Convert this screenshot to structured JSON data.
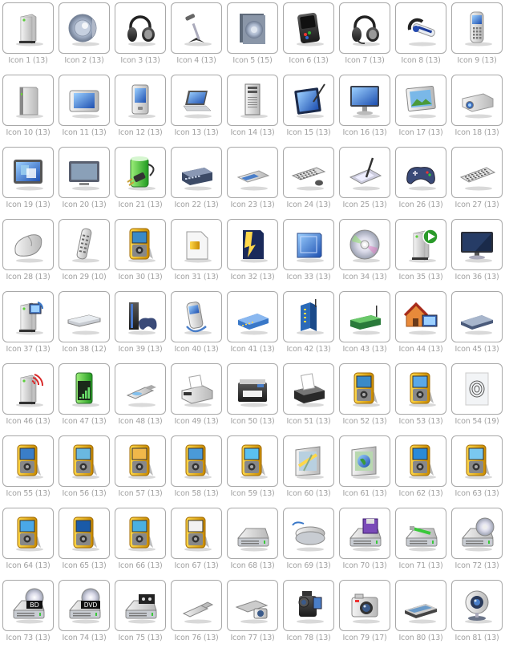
{
  "gallery": {
    "columns": 9,
    "label_color": "#a0a0a0",
    "tile_border_color": "#a8a8a8",
    "items": [
      {
        "label": "Icon 1 (13)",
        "icon": "external-drive-icon"
      },
      {
        "label": "Icon 2 (13)",
        "icon": "speaker-icon"
      },
      {
        "label": "Icon 3 (13)",
        "icon": "headphones-icon"
      },
      {
        "label": "Icon 4 (13)",
        "icon": "desk-microphone-icon"
      },
      {
        "label": "Icon 5 (15)",
        "icon": "speaker-box-icon"
      },
      {
        "label": "Icon 6 (13)",
        "icon": "media-player-icon"
      },
      {
        "label": "Icon 7 (13)",
        "icon": "headset-icon"
      },
      {
        "label": "Icon 8 (13)",
        "icon": "bluetooth-headset-icon"
      },
      {
        "label": "Icon 9 (13)",
        "icon": "mobile-phone-icon"
      },
      {
        "label": "Icon 10 (13)",
        "icon": "hard-drive-slim-icon"
      },
      {
        "label": "Icon 11 (13)",
        "icon": "tablet-pc-icon"
      },
      {
        "label": "Icon 12 (13)",
        "icon": "pda-icon"
      },
      {
        "label": "Icon 13 (13)",
        "icon": "laptop-icon"
      },
      {
        "label": "Icon 14 (13)",
        "icon": "tower-computer-icon"
      },
      {
        "label": "Icon 15 (13)",
        "icon": "pen-tablet-display-icon"
      },
      {
        "label": "Icon 16 (13)",
        "icon": "monitor-icon"
      },
      {
        "label": "Icon 17 (13)",
        "icon": "photo-frame-icon"
      },
      {
        "label": "Icon 18 (13)",
        "icon": "projector-icon"
      },
      {
        "label": "Icon 19 (13)",
        "icon": "display-settings-icon"
      },
      {
        "label": "Icon 20 (13)",
        "icon": "flat-screen-tv-icon"
      },
      {
        "label": "Icon 21 (13)",
        "icon": "battery-power-plug-icon"
      },
      {
        "label": "Icon 22 (13)",
        "icon": "network-switch-icon"
      },
      {
        "label": "Icon 23 (13)",
        "icon": "scanner-flat-icon"
      },
      {
        "label": "Icon 24 (13)",
        "icon": "keyboard-mouse-icon"
      },
      {
        "label": "Icon 25 (13)",
        "icon": "graphics-tablet-icon"
      },
      {
        "label": "Icon 26 (13)",
        "icon": "gamepad-icon"
      },
      {
        "label": "Icon 27 (13)",
        "icon": "keyboard-icon"
      },
      {
        "label": "Icon 28 (13)",
        "icon": "mouse-icon"
      },
      {
        "label": "Icon 29 (10)",
        "icon": "remote-control-icon"
      },
      {
        "label": "Icon 30 (13)",
        "icon": "portable-media-device-icon"
      },
      {
        "label": "Icon 31 (13)",
        "icon": "sim-card-icon"
      },
      {
        "label": "Icon 32 (13)",
        "icon": "memory-card-icon"
      },
      {
        "label": "Icon 33 (13)",
        "icon": "blue-card-reader-icon"
      },
      {
        "label": "Icon 34 (13)",
        "icon": "cd-disc-icon"
      },
      {
        "label": "Icon 35 (13)",
        "icon": "media-server-play-icon"
      },
      {
        "label": "Icon 36 (13)",
        "icon": "widescreen-monitor-icon"
      },
      {
        "label": "Icon 37 (13)",
        "icon": "media-server-video-icon"
      },
      {
        "label": "Icon 38 (12)",
        "icon": "set-top-box-icon"
      },
      {
        "label": "Icon 39 (13)",
        "icon": "game-console-icon"
      },
      {
        "label": "Icon 40 (13)",
        "icon": "smartphone-sync-icon"
      },
      {
        "label": "Icon 41 (13)",
        "icon": "modem-icon"
      },
      {
        "label": "Icon 42 (13)",
        "icon": "wireless-router-icon"
      },
      {
        "label": "Icon 43 (13)",
        "icon": "network-device-green-icon"
      },
      {
        "label": "Icon 44 (13)",
        "icon": "home-network-icon"
      },
      {
        "label": "Icon 45 (13)",
        "icon": "router-flat-icon"
      },
      {
        "label": "Icon 46 (13)",
        "icon": "wireless-server-icon"
      },
      {
        "label": "Icon 47 (13)",
        "icon": "signal-device-icon"
      },
      {
        "label": "Icon 48 (13)",
        "icon": "usb-stick-icon"
      },
      {
        "label": "Icon 49 (13)",
        "icon": "fax-machine-icon"
      },
      {
        "label": "Icon 50 (13)",
        "icon": "multifunction-printer-icon"
      },
      {
        "label": "Icon 51 (13)",
        "icon": "printer-icon"
      },
      {
        "label": "Icon 52 (13)",
        "icon": "portable-device-waveform-icon"
      },
      {
        "label": "Icon 53 (13)",
        "icon": "portable-device-contact-icon"
      },
      {
        "label": "Icon 54 (19)",
        "icon": "fingerprint-reader-icon"
      },
      {
        "label": "Icon 55 (13)",
        "icon": "portable-device-speaker-icon"
      },
      {
        "label": "Icon 56 (13)",
        "icon": "portable-device-camera-icon"
      },
      {
        "label": "Icon 57 (13)",
        "icon": "portable-device-weather-icon"
      },
      {
        "label": "Icon 58 (13)",
        "icon": "portable-device-thermometer-icon"
      },
      {
        "label": "Icon 59 (13)",
        "icon": "portable-device-brightness-icon"
      },
      {
        "label": "Icon 60 (13)",
        "icon": "gps-navigator-icon"
      },
      {
        "label": "Icon 61 (13)",
        "icon": "gps-globe-icon"
      },
      {
        "label": "Icon 62 (13)",
        "icon": "portable-device-settings-icon"
      },
      {
        "label": "Icon 63 (13)",
        "icon": "portable-device-contrast-icon"
      },
      {
        "label": "Icon 64 (13)",
        "icon": "portable-device-fan-icon"
      },
      {
        "label": "Icon 65 (13)",
        "icon": "portable-device-window-icon"
      },
      {
        "label": "Icon 66 (13)",
        "icon": "portable-device-signal-icon"
      },
      {
        "label": "Icon 67 (13)",
        "icon": "portable-device-barcode-icon"
      },
      {
        "label": "Icon 68 (13)",
        "icon": "drive-icon"
      },
      {
        "label": "Icon 69 (13)",
        "icon": "network-drive-icon"
      },
      {
        "label": "Icon 70 (13)",
        "icon": "floppy-drive-icon"
      },
      {
        "label": "Icon 71 (13)",
        "icon": "usb-drive-icon"
      },
      {
        "label": "Icon 72 (13)",
        "icon": "cd-drive-icon"
      },
      {
        "label": "Icon 73 (13)",
        "icon": "bd-drive-icon",
        "badge": "BD"
      },
      {
        "label": "Icon 74 (13)",
        "icon": "dvd-drive-icon",
        "badge": "DVD"
      },
      {
        "label": "Icon 75 (13)",
        "icon": "tape-drive-icon"
      },
      {
        "label": "Icon 76 (13)",
        "icon": "flash-drive-icon"
      },
      {
        "label": "Icon 77 (13)",
        "icon": "scanner-camera-icon"
      },
      {
        "label": "Icon 78 (13)",
        "icon": "video-camera-icon"
      },
      {
        "label": "Icon 79 (17)",
        "icon": "digital-camera-icon"
      },
      {
        "label": "Icon 80 (13)",
        "icon": "flatbed-scanner-icon"
      },
      {
        "label": "Icon 81 (13)",
        "icon": "webcam-icon"
      }
    ]
  }
}
